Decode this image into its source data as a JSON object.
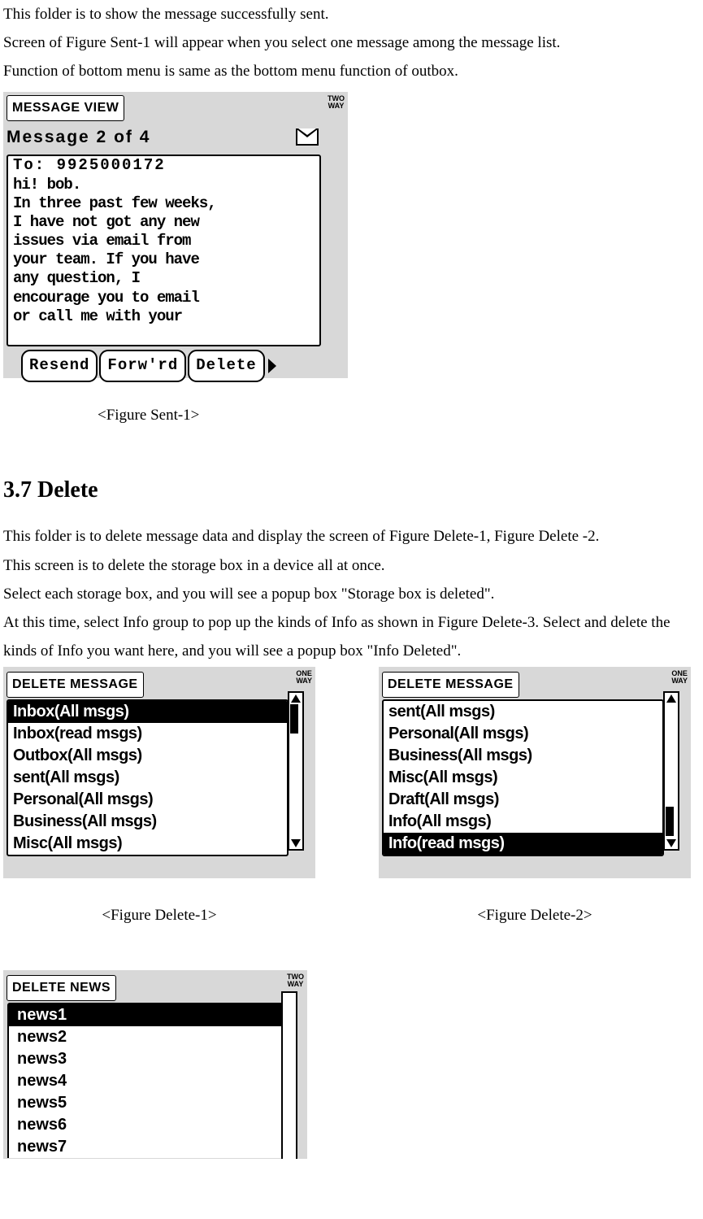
{
  "intro": {
    "p1": "This folder is to show the message successfully sent.",
    "p2": "Screen of Figure Sent-1 will appear when you select one message among the message list.",
    "p3": "Function of bottom menu is same as the bottom menu function of outbox."
  },
  "sent1": {
    "indicator": "TWO\nWAY",
    "header": "MESSAGE VIEW",
    "counter": "Message  2 of 4",
    "to_line": "To: 9925000172",
    "body": "hi! bob.\nIn three past few weeks,\nI have not got any new\nissues via email from\nyour team. If you have\nany question, I\nencourage you to email\nor call me with your",
    "softkeys": {
      "resend": "Resend",
      "forward": "Forw'rd",
      "delete": "Delete"
    },
    "caption": "<Figure Sent-1>"
  },
  "section37": {
    "heading": "3.7 Delete"
  },
  "delete_intro": {
    "p1": "This folder is to delete message data and display the screen of Figure Delete-1, Figure Delete -2.",
    "p2": "This screen is to delete the storage box in a device all at once.",
    "p3": "Select each storage box, and you will see a popup box \"Storage box is deleted\".",
    "p4": "At this time, select Info group to pop up the kinds of Info as shown in Figure Delete-3. Select and delete the kinds of Info you want here, and you will see a popup box \"Info Deleted\"."
  },
  "delete1": {
    "indicator": "ONE\nWAY",
    "header": "DELETE MESSAGE",
    "items": [
      "Inbox(All msgs)",
      "Inbox(read msgs)",
      "Outbox(All msgs)",
      "sent(All msgs)",
      "Personal(All msgs)",
      "Business(All msgs)",
      "Misc(All msgs)"
    ],
    "selected_index": 0,
    "caption": "<Figure Delete-1>"
  },
  "delete2": {
    "indicator": "ONE\nWAY",
    "header": "DELETE MESSAGE",
    "items": [
      "sent(All msgs)",
      "Personal(All msgs)",
      "Business(All msgs)",
      "Misc(All msgs)",
      "Draft(All msgs)",
      "Info(All msgs)",
      "Info(read msgs)"
    ],
    "selected_index": 6,
    "caption": "<Figure Delete-2>"
  },
  "delete3": {
    "indicator": "TWO\nWAY",
    "header": "DELETE NEWS",
    "items": [
      "news1",
      "news2",
      "news3",
      "news4",
      "news5",
      "news6",
      "news7"
    ],
    "selected_index": 0
  }
}
